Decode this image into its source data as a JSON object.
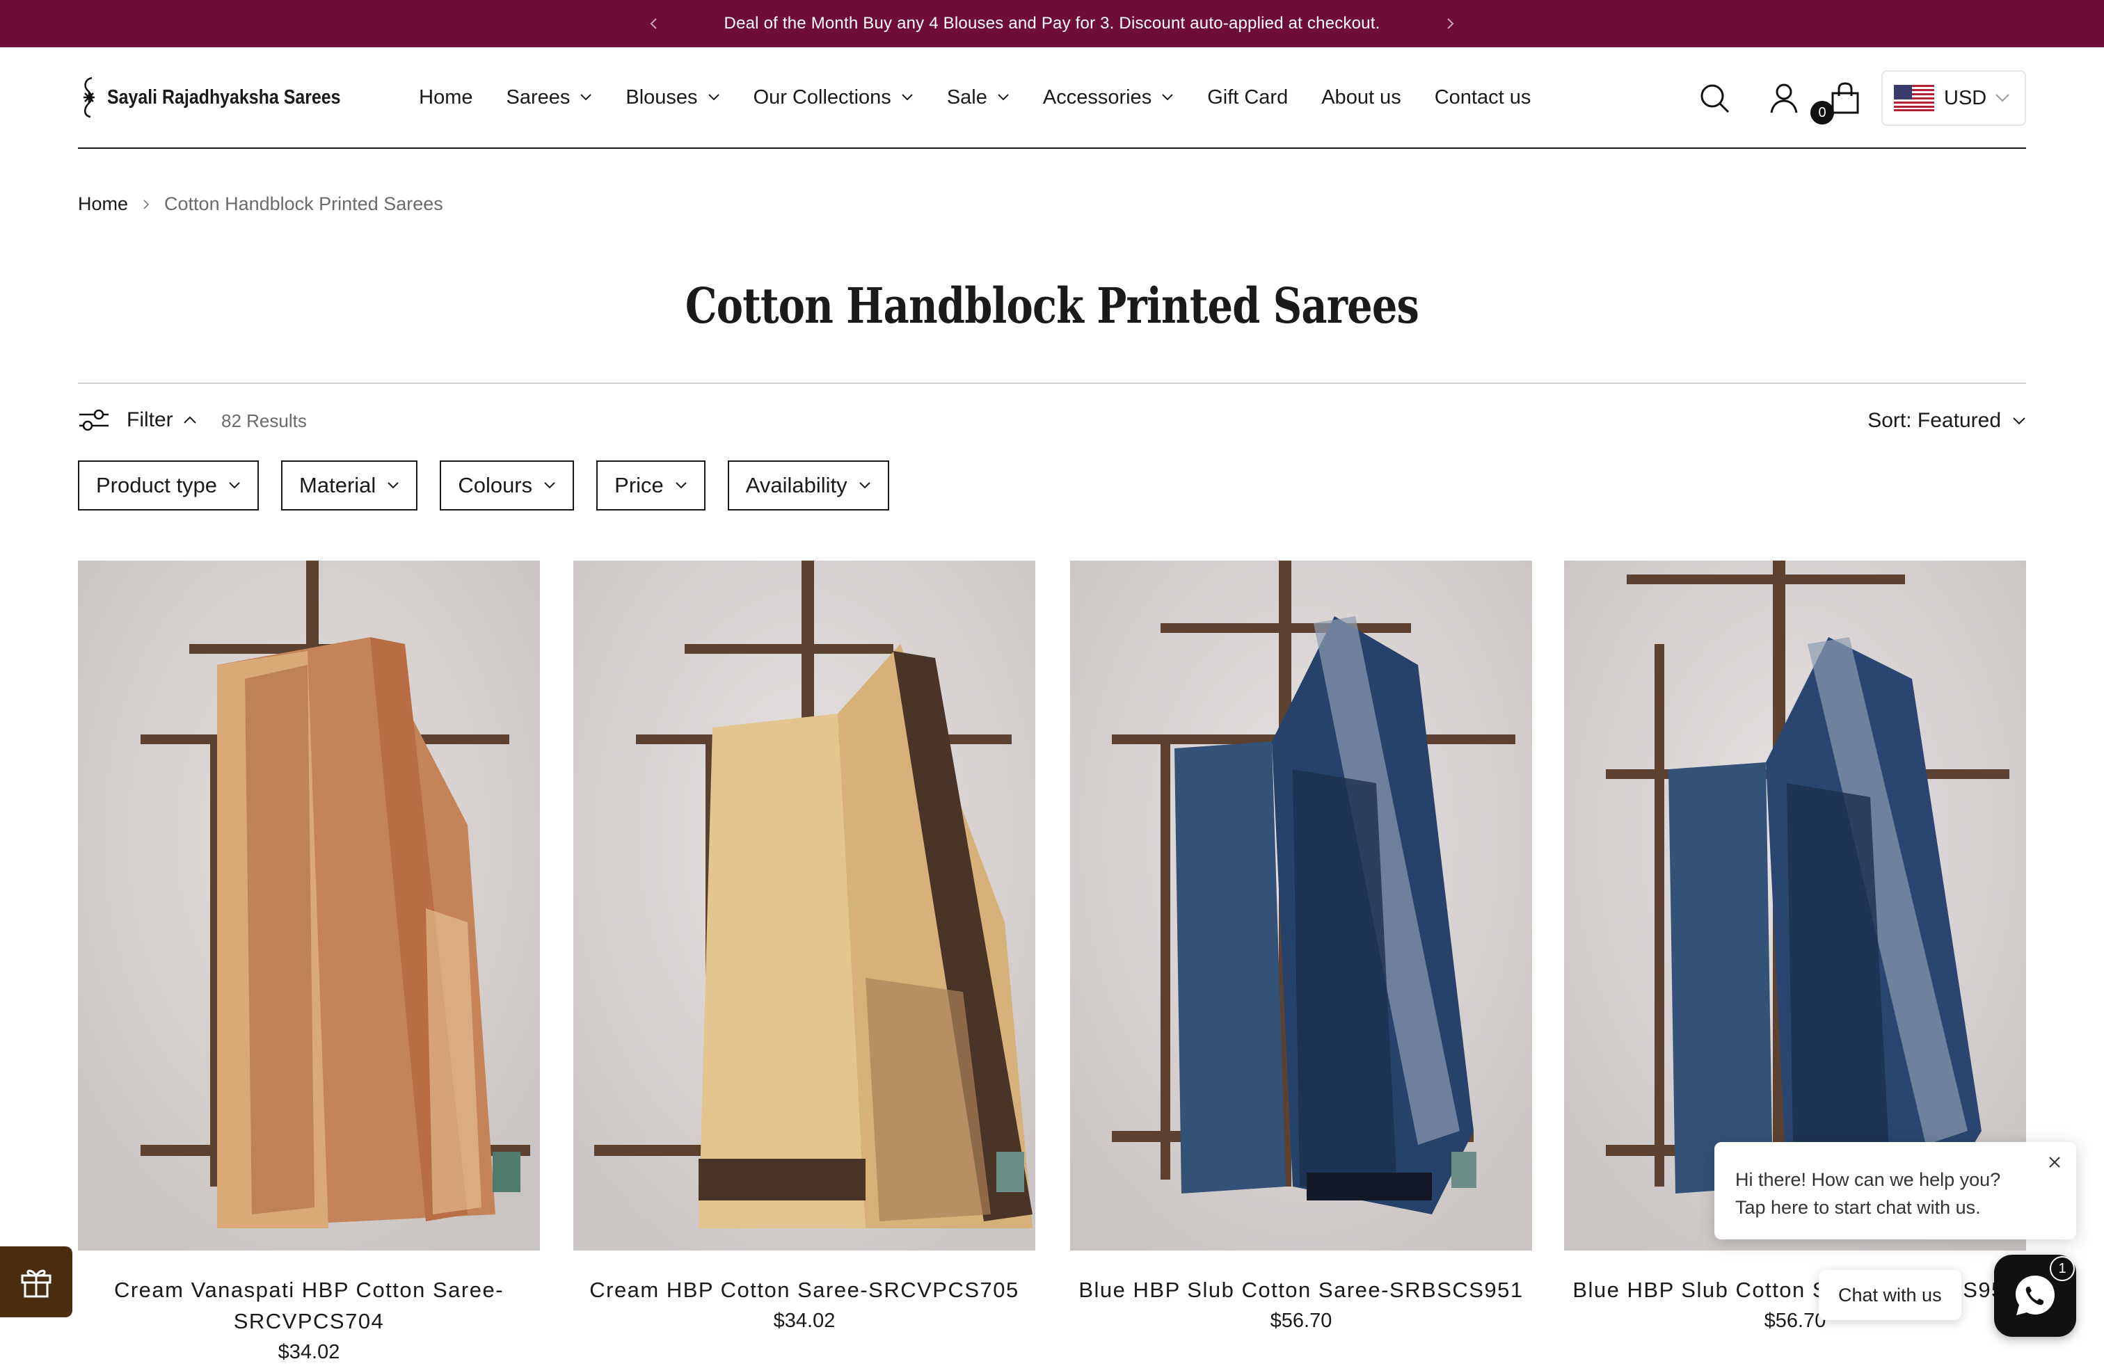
{
  "announcement": {
    "text": "Deal of the Month Buy any 4 Blouses and Pay for 3. Discount auto-applied at checkout."
  },
  "brand": {
    "name": "Sayali Rajadhyaksha Sarees"
  },
  "nav": {
    "items": [
      {
        "label": "Home",
        "dropdown": false
      },
      {
        "label": "Sarees",
        "dropdown": true
      },
      {
        "label": "Blouses",
        "dropdown": true
      },
      {
        "label": "Our Collections",
        "dropdown": true
      },
      {
        "label": "Sale",
        "dropdown": true
      },
      {
        "label": "Accessories",
        "dropdown": true
      },
      {
        "label": "Gift Card",
        "dropdown": false
      },
      {
        "label": "About us",
        "dropdown": false
      },
      {
        "label": "Contact us",
        "dropdown": false
      }
    ]
  },
  "header": {
    "cart_count": "0",
    "currency": "USD"
  },
  "breadcrumb": {
    "home": "Home",
    "current": "Cotton Handblock Printed Sarees"
  },
  "page": {
    "title": "Cotton Handblock Printed Sarees"
  },
  "filters": {
    "toggle_label": "Filter",
    "results": "82 Results",
    "sort_label": "Sort: Featured",
    "buttons": [
      "Product type",
      "Material",
      "Colours",
      "Price",
      "Availability"
    ]
  },
  "products": [
    {
      "title": "Cream Vanaspati HBP Cotton Saree-SRCVPCS704",
      "price": "$34.02",
      "palette": "rust"
    },
    {
      "title": "Cream HBP Cotton Saree-SRCVPCS705",
      "price": "$34.02",
      "palette": "cream"
    },
    {
      "title": "Blue HBP Slub Cotton Saree-SRBSCS951",
      "price": "$56.70",
      "palette": "indigo"
    },
    {
      "title": "Blue HBP Slub Cotton Saree-SRBSCS952",
      "price": "$56.70",
      "palette": "indigo"
    }
  ],
  "chat": {
    "popup_text": "Hi there! How can we help you? Tap here to start chat with us.",
    "button_label": "Chat with us",
    "badge_count": "1"
  },
  "colors": {
    "announcement_bg": "#6e0d3a",
    "gift_tab_bg": "#4a2d10",
    "text": "#1a1a1a",
    "muted": "#6b6b6b"
  },
  "icons": {
    "search": "search-icon",
    "account": "user-icon",
    "cart": "shopping-bag-icon",
    "filter": "sliders-icon",
    "gift": "gift-icon",
    "chat": "whatsapp-icon"
  }
}
